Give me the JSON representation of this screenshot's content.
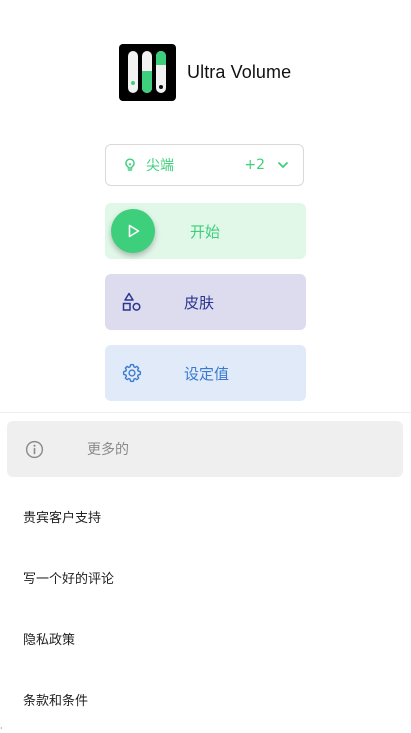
{
  "app": {
    "title": "Ultra Volume"
  },
  "colors": {
    "accent": "#3ecf7c",
    "skin": "#2b3590",
    "settings": "#3a7ad0"
  },
  "tip_selector": {
    "label": "尖端",
    "count": "+2",
    "icon": "bulb-icon"
  },
  "actions": {
    "start_label": "开始",
    "skin_label": "皮肤",
    "settings_label": "设定值"
  },
  "more": {
    "label": "更多的",
    "icon": "info-icon"
  },
  "menu": [
    {
      "label": "贵宾客户支持"
    },
    {
      "label": "写一个好的评论"
    },
    {
      "label": "隐私政策"
    },
    {
      "label": "条款和条件"
    }
  ]
}
